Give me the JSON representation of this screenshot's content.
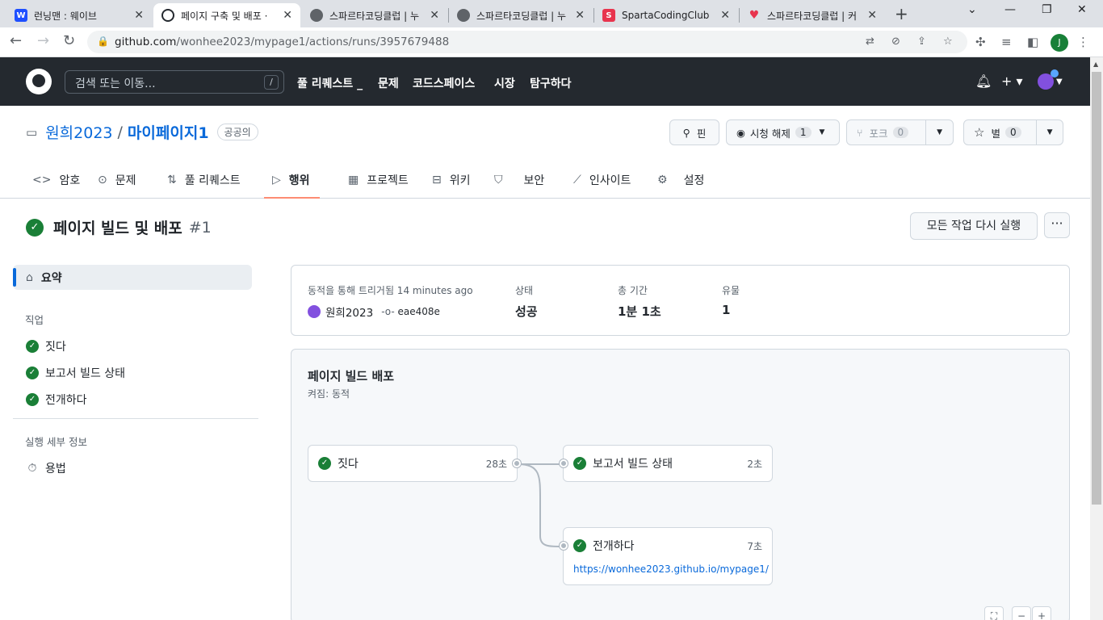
{
  "browser": {
    "tabs": [
      {
        "title": "런닝맨 : 웨이브",
        "icon": "W",
        "icon_color": "#1e4fff"
      },
      {
        "title": "페이지 구축 및 배포 · ",
        "icon": "gh",
        "icon_color": "#24292f"
      },
      {
        "title": "스파르타코딩클럽 | 누",
        "icon": "globe",
        "icon_color": "#5f6368"
      },
      {
        "title": "스파르타코딩클럽 | 누",
        "icon": "globe",
        "icon_color": "#5f6368"
      },
      {
        "title": "SpartaCodingClub",
        "icon": "S",
        "icon_color": "#e8344e"
      },
      {
        "title": "스파르타코딩클럽 | 커",
        "icon": "heart",
        "icon_color": "#e8344e"
      }
    ],
    "url_host": "github.com",
    "url_path": "/wonhee2023/mypage1/actions/runs/3957679488",
    "profile_initial": "J"
  },
  "github": {
    "search_placeholder": "검색 또는 이동...",
    "search_shortcut": "/",
    "nav": [
      "풀 리퀘스트 _",
      "문제",
      "코드스페이스",
      "시장",
      "탐구하다"
    ]
  },
  "repo": {
    "owner": "원희2023",
    "separator": "/",
    "name": "마이페이지1",
    "visibility": "공공의",
    "pin_label": "핀",
    "watch_label": "시청 해제",
    "watch_count": "1",
    "fork_label": "포크",
    "fork_count": "0",
    "star_label": "별",
    "star_count": "0",
    "tabs": [
      {
        "label": "암호",
        "icon": "code-icon"
      },
      {
        "label": "문제",
        "icon": "issue-icon"
      },
      {
        "label": "풀 리퀘스트",
        "icon": "pull-request-icon"
      },
      {
        "label": "행위",
        "icon": "play-icon",
        "selected": true
      },
      {
        "label": "프로젝트",
        "icon": "table-icon"
      },
      {
        "label": "위키",
        "icon": "book-icon"
      },
      {
        "label": "보안",
        "icon": "shield-icon"
      },
      {
        "label": "인사이트",
        "icon": "graph-icon"
      },
      {
        "label": "설정",
        "icon": "gear-icon"
      }
    ]
  },
  "run": {
    "title": "페이지 빌드 및 배포",
    "number": "#1",
    "rerun_label": "모든 작업 다시 실행",
    "more_label": "···"
  },
  "sidebar": {
    "summary_label": "요약",
    "jobs_heading": "직업",
    "jobs": [
      "짓다",
      "보고서 빌드 상태",
      "전개하다"
    ],
    "details_heading": "실행 세부 정보",
    "usage_label": "용법"
  },
  "summary": {
    "trigger_label": "동적을 통해 트리거됨 14 minutes ago",
    "trigger_user": "원희2023",
    "commit": "eae408e",
    "status_label": "상태",
    "status_value": "성공",
    "duration_label": "총 기간",
    "duration_value": "1분 1초",
    "artifacts_label": "유물",
    "artifacts_value": "1"
  },
  "workflow": {
    "title": "페이지 빌드 배포",
    "subtitle": "켜짐: 동적",
    "jobs": [
      {
        "name": "짓다",
        "duration": "28초"
      },
      {
        "name": "보고서 빌드 상태",
        "duration": "2초"
      },
      {
        "name": "전개하다",
        "duration": "7초",
        "link": "https://wonhee2023.github.io/mypage1/"
      }
    ]
  },
  "colors": {
    "success": "#1a7f37",
    "link": "#0969da",
    "header_bg": "#24292f",
    "tab_underline": "#fd8c73"
  }
}
